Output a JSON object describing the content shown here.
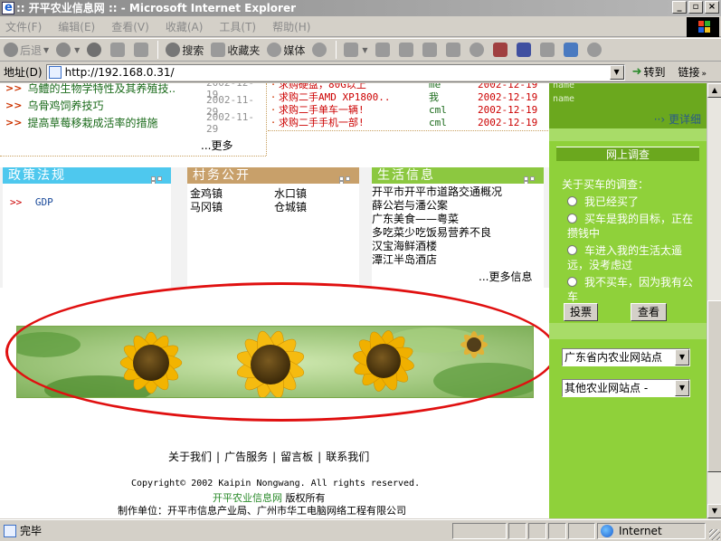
{
  "window": {
    "title": ":: 开平农业信息网 :: - Microsoft Internet Explorer",
    "buttons": [
      "_",
      "▫",
      "×"
    ]
  },
  "menubar": {
    "items": [
      "文件(F)",
      "编辑(E)",
      "查看(V)",
      "收藏(A)",
      "工具(T)",
      "帮助(H)"
    ]
  },
  "toolbar": {
    "back": "后退",
    "search": "搜索",
    "favorites": "收藏夹",
    "media": "媒体"
  },
  "address": {
    "label": "地址(D)",
    "url": "http://192.168.0.31/",
    "go": "转到",
    "links": "链接"
  },
  "news_left": {
    "items": [
      {
        "title": "乌鳢的生物学特性及其养殖技..",
        "date": "2002-12-19"
      },
      {
        "title": "乌骨鸡饲养技巧",
        "date": "2002-11-29"
      },
      {
        "title": "提高草莓移栽成活率的措施",
        "date": "2002-11-29"
      }
    ],
    "more": "...更多"
  },
  "news_right": {
    "items": [
      {
        "title": "求购硬盘，80G以上",
        "user": "me",
        "date": "2002-12-19"
      },
      {
        "title": "求购二手AMD XP1800..",
        "user": "我",
        "date": "2002-12-19"
      },
      {
        "title": "求购二手单车一辆!",
        "user": "cml",
        "date": "2002-12-19"
      },
      {
        "title": "求购二手手机一部!",
        "user": "cml",
        "date": "2002-12-19"
      }
    ]
  },
  "sidebar": {
    "name_label_1": "name",
    "name_label_2": "name",
    "more": "更详细",
    "survey_title": "网上调查",
    "question": "关于买车的调查：",
    "options": [
      "我已经买了",
      "买车是我的目标，正在攒钱中",
      "车进入我的生活太遥远，没考虑过",
      "我不买车，因为我有公车"
    ],
    "vote": "投票",
    "view": "查看",
    "select_1": "广东省内农业网站点",
    "select_2": "其他农业网站点 -"
  },
  "boxes": {
    "policy": {
      "title": "政策法规",
      "item": "GDP",
      "color": "#4ec8ee"
    },
    "village": {
      "title": "村务公开",
      "towns": [
        "金鸡镇",
        "水口镇",
        "马冈镇",
        "仓城镇"
      ],
      "color": "#c8a06a"
    },
    "life": {
      "title": "生活信息",
      "color": "#8cc840",
      "items": [
        "开平市开平市道路交通概况",
        "薛公岩与潘公案",
        "广东美食——粤菜",
        "多吃菜少吃饭易营养不良",
        "汉宝海鲜酒楼",
        "潭江半岛酒店"
      ],
      "more": "...更多信息"
    }
  },
  "footer": {
    "links": [
      "关于我们",
      "广告服务",
      "留言板",
      "联系我们"
    ],
    "copyright": "Copyright© 2002 Kaipin Nongwang. All rights reserved.",
    "site_name": "开平农业信息网",
    "site_suffix": " 版权所有",
    "maker": "制作单位：开平市信息产业局、广州市华工电脑网络工程有限公司"
  },
  "status": {
    "text": "完毕",
    "zone": "Internet"
  },
  "colors": {
    "sidebar": "#8fd13a",
    "sidebar_dark": "#6ba81e",
    "annotation": "#e01010"
  }
}
